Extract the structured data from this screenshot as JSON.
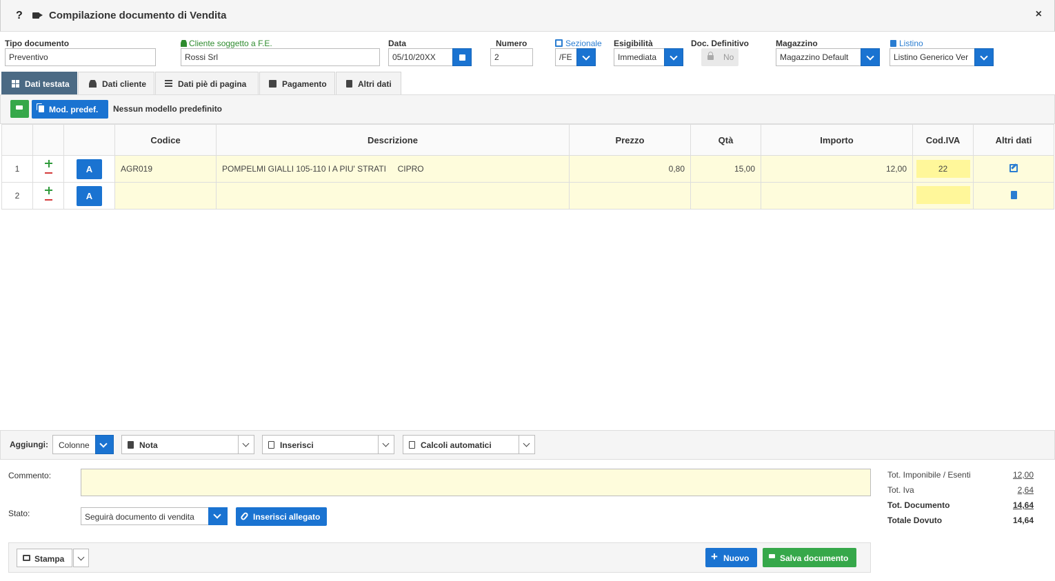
{
  "window": {
    "title": "Compilazione documento di Vendita",
    "help": "?",
    "close": "×"
  },
  "header": {
    "tipo_documento": {
      "label": "Tipo documento",
      "value": "Preventivo"
    },
    "cliente": {
      "label": "Cliente soggetto a F.E.",
      "value": "Rossi Srl"
    },
    "data": {
      "label": "Data",
      "value": "05/10/20XX"
    },
    "numero": {
      "label": "Numero",
      "value": "2"
    },
    "sezionale": {
      "label": "Sezionale",
      "value": "/FE"
    },
    "esigibilita": {
      "label": "Esigibilità",
      "value": "Immediata"
    },
    "doc_definitivo": {
      "label": "Doc. Definitivo",
      "value": "No"
    },
    "magazzino": {
      "label": "Magazzino",
      "value": "Magazzino Default"
    },
    "listino": {
      "label": "Listino",
      "value": "Listino Generico Ver"
    }
  },
  "tabs": [
    {
      "label": "Dati testata",
      "icon": "table-icon",
      "active": true
    },
    {
      "label": "Dati cliente",
      "icon": "user-icon"
    },
    {
      "label": "Dati piè di pagina",
      "icon": "list-icon"
    },
    {
      "label": "Pagamento",
      "icon": "calendar-icon"
    },
    {
      "label": "Altri dati",
      "icon": "file-icon"
    }
  ],
  "toolbar": {
    "mod_predef_label": "Mod. predef.",
    "no_model_text": "Nessun modello predefinito"
  },
  "grid": {
    "columns": [
      "",
      "",
      "",
      "Codice",
      "Descrizione",
      "Prezzo",
      "Qtà",
      "Importo",
      "Cod.IVA",
      "Altri dati"
    ],
    "rows": [
      {
        "n": "1",
        "a_label": "A",
        "codice": "AGR019",
        "descrizione": "POMPELMI GIALLI 105-110 I A PIU' STRATI     CIPRO",
        "prezzo": "0,80",
        "qta": "15,00",
        "importo": "12,00",
        "cod_iva": "22"
      },
      {
        "n": "2",
        "a_label": "A",
        "codice": "",
        "descrizione": "",
        "prezzo": "",
        "qta": "",
        "importo": "",
        "cod_iva": ""
      }
    ]
  },
  "add_bar": {
    "label": "Aggiungi:",
    "colonne": "Colonne",
    "nota": "Nota",
    "inserisci": "Inserisci",
    "calcoli": "Calcoli automatici"
  },
  "bottom": {
    "commento_label": "Commento:",
    "commento_value": "",
    "stato_label": "Stato:",
    "stato_value": "Seguirà documento di vendita",
    "allegato_label": "Inserisci allegato"
  },
  "totals": [
    {
      "label": "Tot. Imponibile / Esenti",
      "value": "12,00"
    },
    {
      "label": "Tot. Iva",
      "value": "2,64"
    },
    {
      "label": "Tot. Documento",
      "value": "14,64"
    },
    {
      "label": "Totale Dovuto",
      "value": "14,64"
    }
  ],
  "footer": {
    "stampa_label": "Stampa",
    "nuovo_label": "Nuovo",
    "salva_label": "Salva documento"
  },
  "colors": {
    "primary": "#1a73d1",
    "success": "#36a84a",
    "active_tab": "#4b6a84",
    "row_highlight": "#fefcdc",
    "iva_highlight": "#fff79a"
  }
}
